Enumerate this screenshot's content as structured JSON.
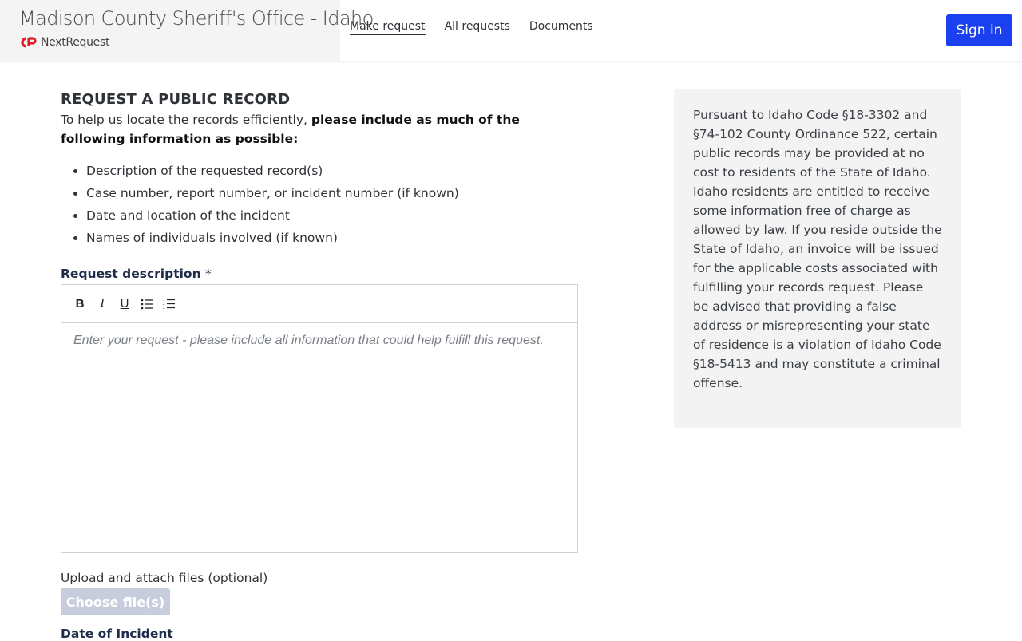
{
  "header": {
    "agency_name": "Madison County Sheriff's Office - Idaho",
    "product_name": "NextRequest",
    "brand_color": "#e31b23",
    "nav": [
      {
        "label": "Make request",
        "active": true
      },
      {
        "label": "All requests",
        "active": false
      },
      {
        "label": "Documents",
        "active": false
      }
    ],
    "sign_in_label": "Sign in",
    "sign_in_color": "#1a40f0"
  },
  "main": {
    "heading": "REQUEST A PUBLIC RECORD",
    "intro_text": "To help us locate the records efficiently, ",
    "intro_emphasis": "please include as much of the following information as possible:",
    "tips": [
      "Description of the requested record(s)",
      "Case number, report number, or incident number (if known)",
      "Date and location of the incident",
      "Names of individuals involved (if known)"
    ],
    "description_label": "Request description",
    "required_marker": "*",
    "toolbar": [
      {
        "icon": "bold-icon",
        "label": "B"
      },
      {
        "icon": "italic-icon",
        "label": "I"
      },
      {
        "icon": "underline-icon",
        "label": "U"
      },
      {
        "icon": "bulleted-list-icon",
        "label": ""
      },
      {
        "icon": "numbered-list-icon",
        "label": ""
      }
    ],
    "description_placeholder": "Enter your request - please include all information that could help fulfill this request.",
    "upload_label": "Upload and attach files (optional)",
    "choose_files_label": "Choose file(s)",
    "date_label": "Date of Incident"
  },
  "notice": {
    "text": "Pursuant to Idaho Code §18-3302 and §74-102 County Ordinance 522, certain public records may be provided at no cost to residents of the State of Idaho. Idaho residents are entitled to receive some information free of charge as allowed by law. If you reside outside the State of Idaho, an invoice will be issued for the applicable costs associated with fulfilling your records request. Please be advised that providing a false address or misrepresenting your state of residence is a violation of Idaho Code §18-5413 and may constitute a criminal offense."
  }
}
